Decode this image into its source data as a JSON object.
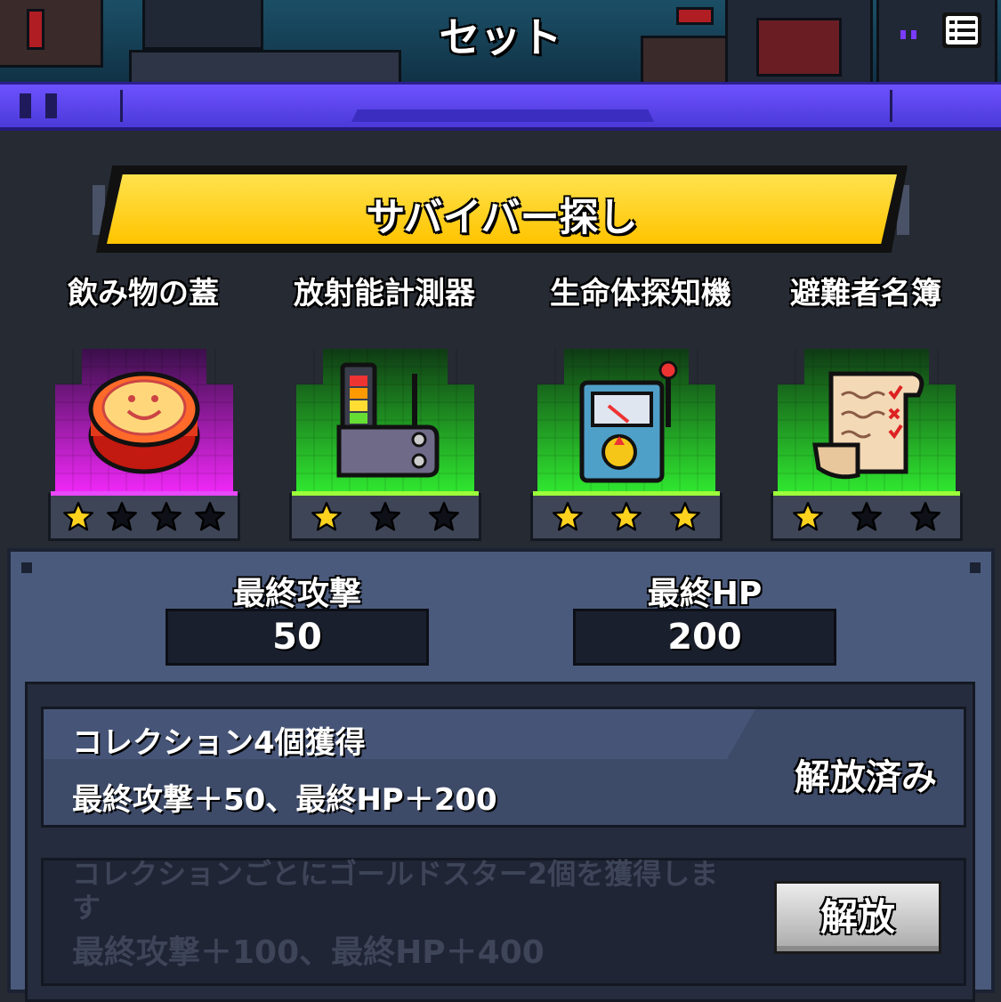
{
  "header": {
    "title": "セット"
  },
  "set": {
    "name": "サバイバー探し"
  },
  "items": [
    {
      "name": "飲み物の蓋",
      "icon": "bottle-cap-icon",
      "stars": 1,
      "max_stars": 4,
      "rarity_color": "#e020e8"
    },
    {
      "name": "放射能計測器",
      "icon": "radiation-meter-icon",
      "stars": 1,
      "max_stars": 3,
      "rarity_color": "#22d422"
    },
    {
      "name": "生命体探知機",
      "icon": "life-detector-icon",
      "stars": 3,
      "max_stars": 3,
      "rarity_color": "#22d422"
    },
    {
      "name": "避難者名簿",
      "icon": "refugee-list-icon",
      "stars": 1,
      "max_stars": 3,
      "rarity_color": "#22d422"
    }
  ],
  "stats": {
    "attack_label": "最終攻撃",
    "attack_value": "50",
    "hp_label": "最終HP",
    "hp_value": "200"
  },
  "bonuses": [
    {
      "title": "コレクション4個獲得",
      "desc": "最終攻撃＋50、最終HP＋200",
      "status": "解放済み"
    },
    {
      "title": "コレクションごとにゴールドスター2個を獲得します",
      "desc": "最終攻撃＋100、最終HP＋400",
      "button": "解放"
    }
  ]
}
